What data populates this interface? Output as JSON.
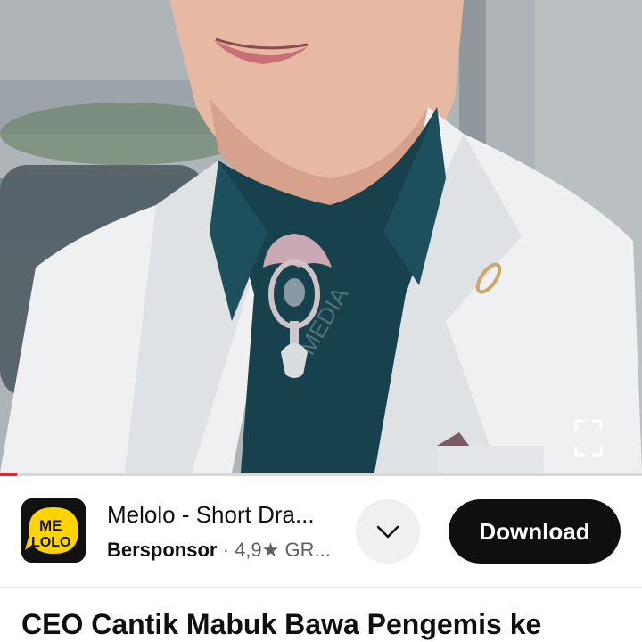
{
  "video": {
    "progress_fraction": 0.027,
    "watermark_text": "MEDIA"
  },
  "ad": {
    "app_name": "Melolo - Short Dra...",
    "sponsor_label": "Bersponsor",
    "separator": "·",
    "rating": "4,9",
    "rating_star": "★",
    "category": "GR...",
    "download_label": "Download",
    "logo_text_top": "ME",
    "logo_text_bottom": "LOLO"
  },
  "video_title": "CEO Cantik Mabuk Bawa Pengemis ke",
  "colors": {
    "progress": "#e8232a",
    "download_bg": "#0f0f0f",
    "logo_yellow": "#ffd400"
  },
  "icons": {
    "fullscreen": "fullscreen-icon",
    "expand": "chevron-down-icon"
  }
}
